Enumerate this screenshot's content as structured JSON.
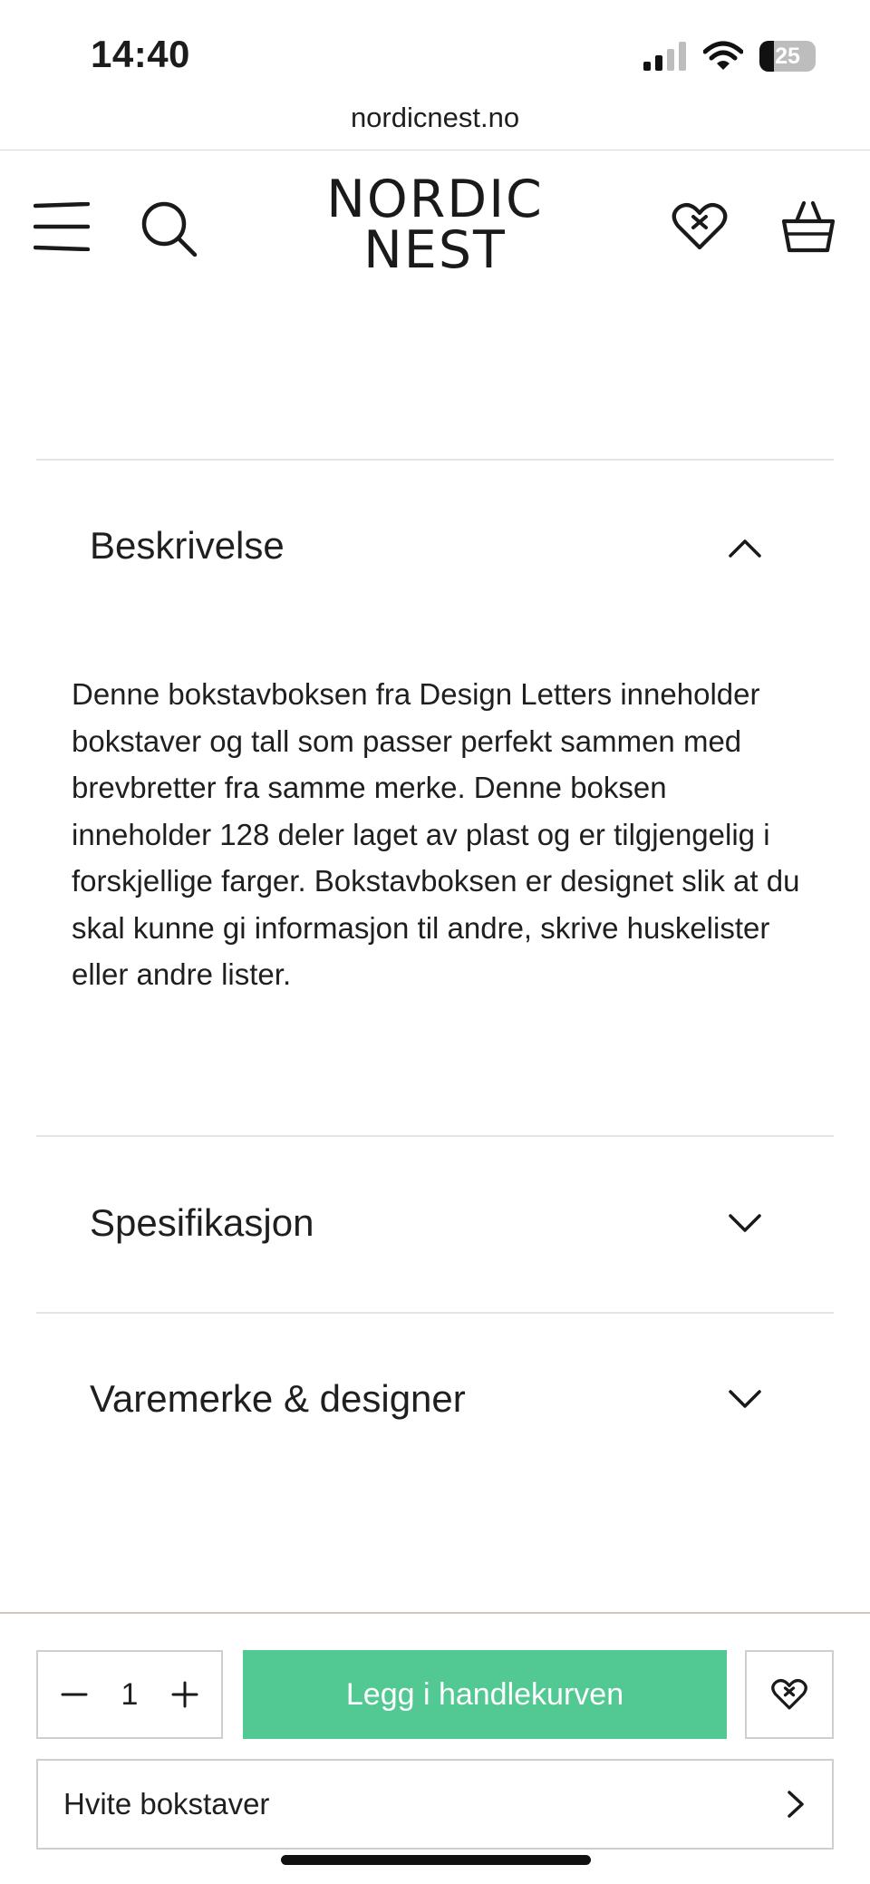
{
  "status_bar": {
    "time": "14:40",
    "battery_level": "25"
  },
  "browser": {
    "url": "nordicnest.no"
  },
  "header": {
    "logo_line1": "NORDIC",
    "logo_line2": "NEST",
    "icons": [
      "menu-icon",
      "search-icon",
      "heart-icon",
      "basket-icon"
    ]
  },
  "accordion": [
    {
      "title": "Beskrivelse",
      "expanded": true,
      "body": "Denne bokstavboksen fra Design Letters inneholder bokstaver og tall som passer perfekt sammen med brevbretter fra samme merke. Denne boksen inneholder 128 deler laget av plast og er tilgjengelig i forskjellige farger. Bokstavboksen er designet slik at du skal kunne gi informasjon til andre, skrive huskelister eller andre lister."
    },
    {
      "title": "Spesifikasjon",
      "expanded": false
    },
    {
      "title": "Varemerke & designer",
      "expanded": false
    }
  ],
  "purchase": {
    "quantity": "1",
    "add_to_cart_label": "Legg i handlekurven",
    "variant_label": "Hvite bokstaver"
  },
  "colors": {
    "accent_green": "#52c992",
    "text": "#1f1f1f",
    "divider": "#e4e4e4"
  }
}
